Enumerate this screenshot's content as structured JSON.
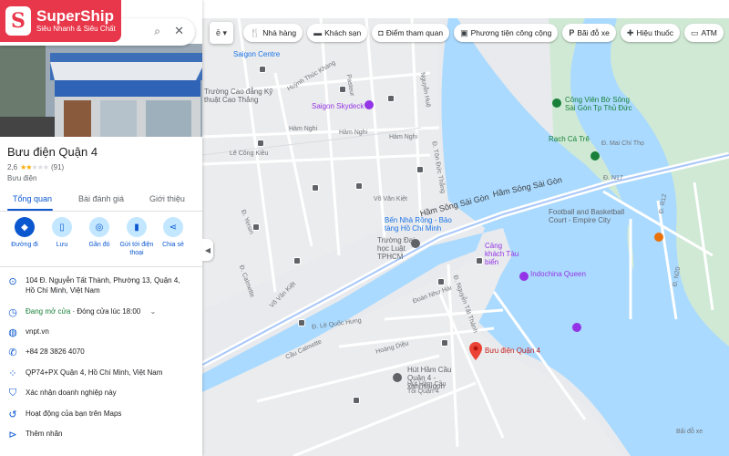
{
  "brand": {
    "name": "SuperShip",
    "tagline": "Siêu Nhanh & Siêu Chất",
    "letter": "S",
    "color": "#e8374a"
  },
  "chips": [
    {
      "icon": "fork-knife-icon",
      "glyph": "🍴",
      "label": "Nhà hàng"
    },
    {
      "icon": "bed-icon",
      "glyph": "🛏",
      "label": "Khách sạn"
    },
    {
      "icon": "camera-icon",
      "glyph": "📷",
      "label": "Điểm tham quan"
    },
    {
      "icon": "transit-icon",
      "glyph": "🚌",
      "label": "Phương tiện công cộng"
    },
    {
      "icon": "parking-icon",
      "glyph": "P",
      "label": "Bãi đỗ xe"
    },
    {
      "icon": "pharmacy-icon",
      "glyph": "✚",
      "label": "Hiệu thuốc"
    },
    {
      "icon": "atm-icon",
      "glyph": "▭",
      "label": "ATM"
    }
  ],
  "place": {
    "title": "Bưu điện Quận 4",
    "rating": "2,6",
    "reviews": "(91)",
    "category": "Bưu điện"
  },
  "tabs": [
    "Tổng quan",
    "Bài đánh giá",
    "Giới thiệu"
  ],
  "actions": [
    {
      "icon": "directions-icon",
      "glyph": "◆",
      "label": "Đường đi"
    },
    {
      "icon": "bookmark-icon",
      "glyph": "▯",
      "label": "Lưu"
    },
    {
      "icon": "nearby-icon",
      "glyph": "◎",
      "label": "Gần đó"
    },
    {
      "icon": "send-to-phone-icon",
      "glyph": "▮",
      "label": "Gửi tới điện thoại"
    },
    {
      "icon": "share-icon",
      "glyph": "⋖",
      "label": "Chia sẻ"
    }
  ],
  "info": {
    "address": "104 Đ. Nguyễn Tất Thành, Phường 13, Quận 4, Hồ Chí Minh, Việt Nam",
    "hours_status": "Đang mở cửa",
    "hours_detail": " · Đóng cửa lúc 18:00",
    "website": "vnpt.vn",
    "phone": "+84 28 3826 4070",
    "plus_code": "QP74+PX Quận 4, Hồ Chí Minh, Việt Nam",
    "claim": "Xác nhận doanh nghiệp này",
    "activity": "Hoạt động của bạn trên Maps",
    "add_label": "Thêm nhãn"
  },
  "map_labels": {
    "saigon_centre": "Saigon Centre",
    "skydeck": "Saigon Skydeck",
    "cao_thang": "Trường Cao đẳng Kỹ thuật Cao Thắng",
    "ham_nghi_1": "Hàm Nghi",
    "ham_nghi_2": "Hàm Nghi",
    "ham_nghi_3": "Hàm Nghi",
    "vo_van_kiet": "Võ Văn Kiệt",
    "tunnel_1": "Hầm Sông Sài Gòn",
    "tunnel_2": "Hầm Sông Sài Gòn",
    "cong_vien": "Công Viên Bờ Sông Sài Gòn Tp Thủ Đức",
    "rach_ca_tre": "Rạch Cá Trê",
    "mai_chi_tho": "Đ. Mai Chí Thọ",
    "football": "Football and Basketball Court - Empire City",
    "ben_nha_rong": "Bến Nhà Rồng - Bảo tàng Hồ Chí Minh",
    "truong_dh_luat": "Trường Đại học Luật TPHCM",
    "cang_khanh_hoi": "Cảng khách Tàu biển",
    "indochina": "Indochina Queen",
    "buu_dien": "Bưu điện Quận 4",
    "hut_ham": "Hút Hầm Cầu Quận 4 - xanhsaigon",
    "hut_ham_sub": "Hút Hầm Cầu Tối Quận 4",
    "calmette": "Đ. Calmette",
    "hoang_dieu": "Hoàng Diệu",
    "nguyen_tat_thanh": "Đ. Nguyễn Tất Thành",
    "le_quoc_hung": "Đ. Lê Quốc Hưng",
    "cau_calmette": "Cầu Calmette",
    "doan_nhu_hai": "Đoàn Như Hài",
    "n17": "Đ. N17",
    "n20": "Đ. N20",
    "r12": "Đ. R12",
    "bai_do_xe": "Bãi đỗ xe",
    "pasteur": "Pasteur",
    "nguyen_hue": "Nguyễn Huệ",
    "huynh_thuc_khang": "Huỳnh Thúc Kháng",
    "le_cong_kieu": "Lê Công Kiều",
    "yersin": "Đ. Yersin",
    "ton_duc_thang": "Đ. Tôn Đức Thắng"
  }
}
